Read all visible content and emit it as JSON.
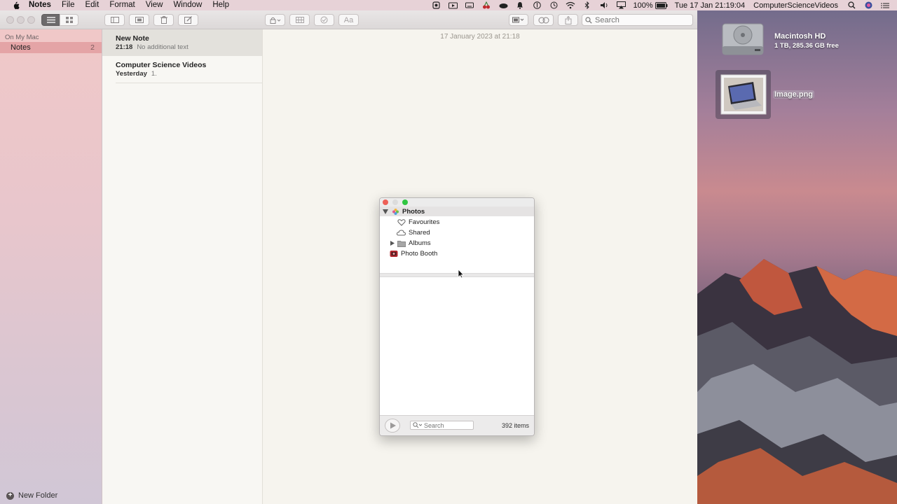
{
  "menubar": {
    "app_name": "Notes",
    "items": [
      "File",
      "Edit",
      "Format",
      "View",
      "Window",
      "Help"
    ],
    "battery": "100%",
    "datetime": "Tue 17 Jan  21:19:04",
    "username": "ComputerScienceVideos"
  },
  "toolbar": {
    "search_placeholder": "Search"
  },
  "sidebar": {
    "section_label": "On My Mac",
    "folder_label": "Notes",
    "folder_count": "2",
    "new_folder_label": "New Folder"
  },
  "notes_list": [
    {
      "title": "New Note",
      "time": "21:18",
      "preview": "No additional text"
    },
    {
      "title": "Computer Science Videos",
      "time": "Yesterday",
      "preview": "1."
    }
  ],
  "editor": {
    "date": "17 January 2023 at 21:18"
  },
  "desktop": {
    "disk_name": "Macintosh HD",
    "disk_info": "1 TB, 285.36 GB free",
    "file_name": "Image.png"
  },
  "media_browser": {
    "header": "Photos",
    "items": [
      "Favourites",
      "Shared",
      "Albums",
      "Photo Booth"
    ],
    "search_placeholder": "Search",
    "count": "392 items"
  },
  "colors": {
    "close": "#ed5f57",
    "minimize": "#dcdcdc",
    "zoom": "#2fc641",
    "sidebar_selection": "#d7787d"
  }
}
